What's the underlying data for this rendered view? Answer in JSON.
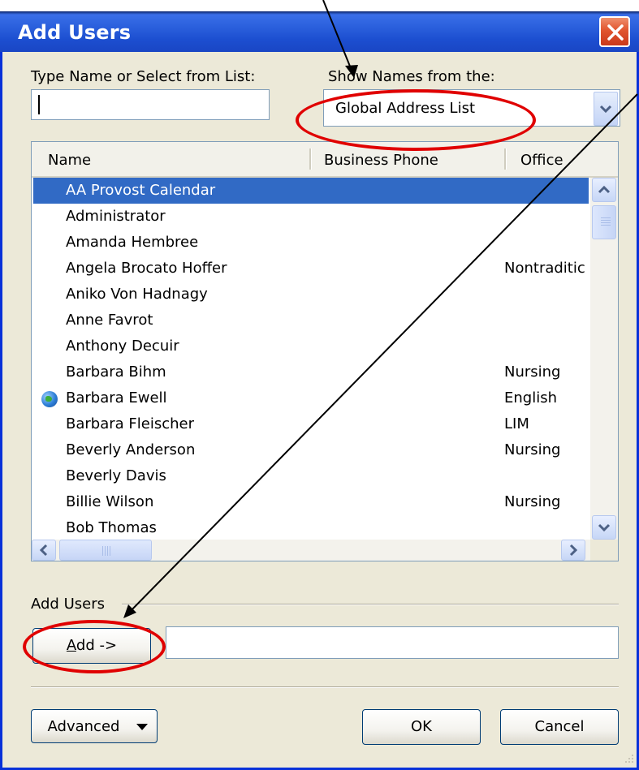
{
  "window": {
    "title": "Add Users"
  },
  "form": {
    "type_name_label": "Type Name or Select from List:",
    "type_name_value": "",
    "show_names_label": "Show Names from the:",
    "address_book_value": "Global Address List"
  },
  "list": {
    "columns": [
      "Name",
      "Business Phone",
      "Office"
    ],
    "rows": [
      {
        "name": "AA Provost Calendar",
        "office": "",
        "selected": true,
        "icon": ""
      },
      {
        "name": "Administrator",
        "office": "",
        "icon": ""
      },
      {
        "name": "Amanda Hembree",
        "office": "",
        "icon": ""
      },
      {
        "name": "Angela Brocato Hoffer",
        "office": "Nontraditic",
        "icon": ""
      },
      {
        "name": "Aniko Von Hadnagy",
        "office": "",
        "icon": ""
      },
      {
        "name": "Anne Favrot",
        "office": "",
        "icon": ""
      },
      {
        "name": "Anthony Decuir",
        "office": "",
        "icon": ""
      },
      {
        "name": "Barbara Bihm",
        "office": "Nursing",
        "icon": ""
      },
      {
        "name": "Barbara Ewell",
        "office": "English",
        "icon": "globe-icon"
      },
      {
        "name": "Barbara Fleischer",
        "office": "LIM",
        "icon": ""
      },
      {
        "name": "Beverly Anderson",
        "office": "Nursing",
        "icon": ""
      },
      {
        "name": "Beverly Davis",
        "office": "",
        "icon": ""
      },
      {
        "name": "Billie Wilson",
        "office": "Nursing",
        "icon": ""
      },
      {
        "name": "Bob Thomas",
        "office": "",
        "icon": ""
      }
    ]
  },
  "add_users": {
    "group_label": "Add Users",
    "add_button": "Add ->",
    "selected_value": ""
  },
  "footer": {
    "advanced_button": "Advanced",
    "ok_button": "OK",
    "cancel_button": "Cancel"
  },
  "colors": {
    "titlebar": "#2a5fdc",
    "selection": "#316ac5",
    "annotation_red": "#e00000",
    "dialog_face": "#ece9d8"
  }
}
